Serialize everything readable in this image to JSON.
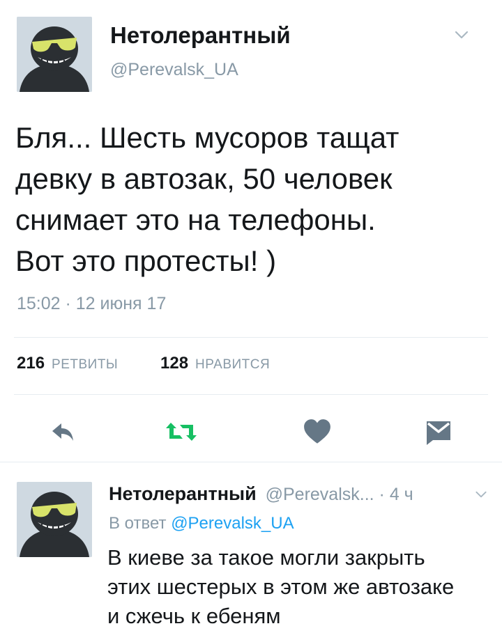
{
  "tweet": {
    "author_name": "Нетолерантный",
    "author_handle": "@Perevalsk_UA",
    "text_lines": [
      "Бля... Шесть мусоров тащат",
      "девку в автозак, 50 человек",
      "снимает это на телефоны.",
      "Вот это протесты! )"
    ],
    "timestamp": "15:02 · 12 июня 17",
    "retweets_count": "216",
    "retweets_label": "РЕТВИТЫ",
    "likes_count": "128",
    "likes_label": "НРАВИТСЯ"
  },
  "actions": {
    "reply_icon": "reply-icon",
    "retweet_icon": "retweet-icon",
    "like_icon": "heart-icon",
    "dm_icon": "message-icon"
  },
  "reply": {
    "author_name": "Нетолерантный",
    "author_handle": "@Perevalsk...",
    "separator": " · ",
    "time": "4 ч",
    "in_reply_prefix": "В ответ",
    "in_reply_handle": "@Perevalsk_UA",
    "text_lines": [
      "В киеве за такое могли закрыть",
      "этих шестерых в этом же автозаке",
      "и сжечь к ебеням"
    ]
  },
  "colors": {
    "accent": "#1da1f2",
    "retweet_green": "#17bf63",
    "icon_gray": "#657786",
    "muted": "#8899a6"
  }
}
